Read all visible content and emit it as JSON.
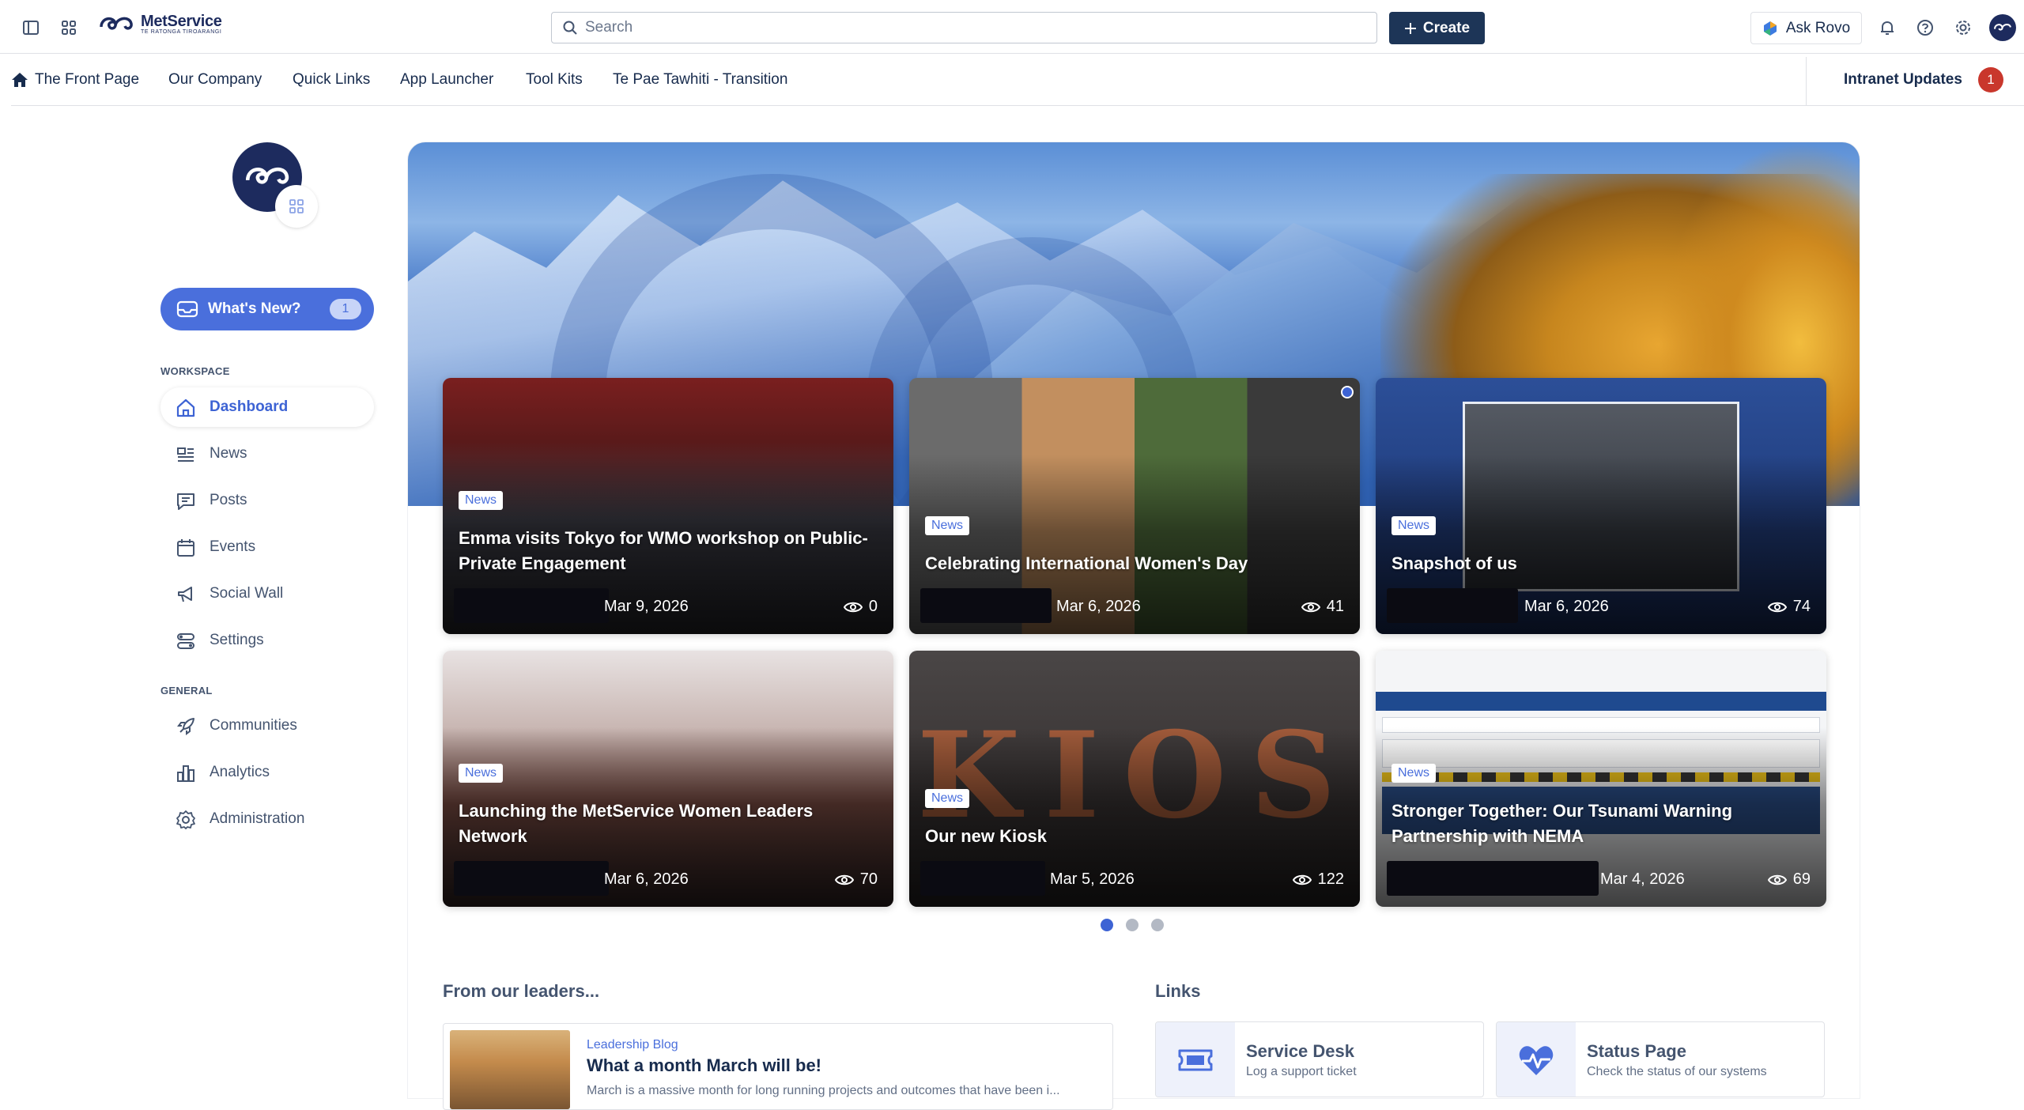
{
  "topbar": {
    "brand": "MetService",
    "brand_sub": "TE RATONGA TIROARANGI",
    "search_placeholder": "Search",
    "create_label": "Create",
    "ask_rovo_label": "Ask Rovo"
  },
  "nav": {
    "items": [
      "The Front Page",
      "Our Company",
      "Quick Links",
      "App Launcher",
      "Tool Kits",
      "Te Pae Tawhiti - Transition"
    ],
    "intranet_updates": "Intranet Updates",
    "intranet_count": "1"
  },
  "sidebar": {
    "whats_new": "What's New?",
    "whats_new_count": "1",
    "workspace_heading": "WORKSPACE",
    "workspace_items": [
      "Dashboard",
      "News",
      "Posts",
      "Events",
      "Social Wall",
      "Settings"
    ],
    "general_heading": "GENERAL",
    "general_items": [
      "Communities",
      "Analytics",
      "Administration"
    ]
  },
  "cards": [
    {
      "tag": "News",
      "title": "Emma visits Tokyo for WMO workshop on Public-Private Engagement",
      "date": "Mar 9, 2026",
      "views": "0"
    },
    {
      "tag": "News",
      "title": "Celebrating International Women's Day",
      "date": "Mar 6, 2026",
      "views": "41"
    },
    {
      "tag": "News",
      "title": "Snapshot of us",
      "date": "Mar 6, 2026",
      "views": "74"
    },
    {
      "tag": "News",
      "title": "Launching the MetService Women Leaders Network",
      "date": "Mar 6, 2026",
      "views": "70"
    },
    {
      "tag": "News",
      "title": "Our new Kiosk",
      "date": "Mar 5, 2026",
      "views": "122"
    },
    {
      "tag": "News",
      "title": "Stronger Together: Our Tsunami Warning Partnership with NEMA",
      "date": "Mar 4, 2026",
      "views": "69"
    }
  ],
  "leaders": {
    "heading": "From our leaders...",
    "category": "Leadership Blog",
    "title": "What a month March will be!",
    "excerpt": "March is a massive month for long running projects and outcomes that have been i..."
  },
  "links": {
    "heading": "Links",
    "items": [
      {
        "name": "Service Desk",
        "desc": "Log a support ticket"
      },
      {
        "name": "Status Page",
        "desc": "Check the status of our systems"
      }
    ]
  },
  "colors": {
    "accent": "#4a6fdc",
    "primary_button": "#1d3557",
    "badge": "#c9372c"
  }
}
